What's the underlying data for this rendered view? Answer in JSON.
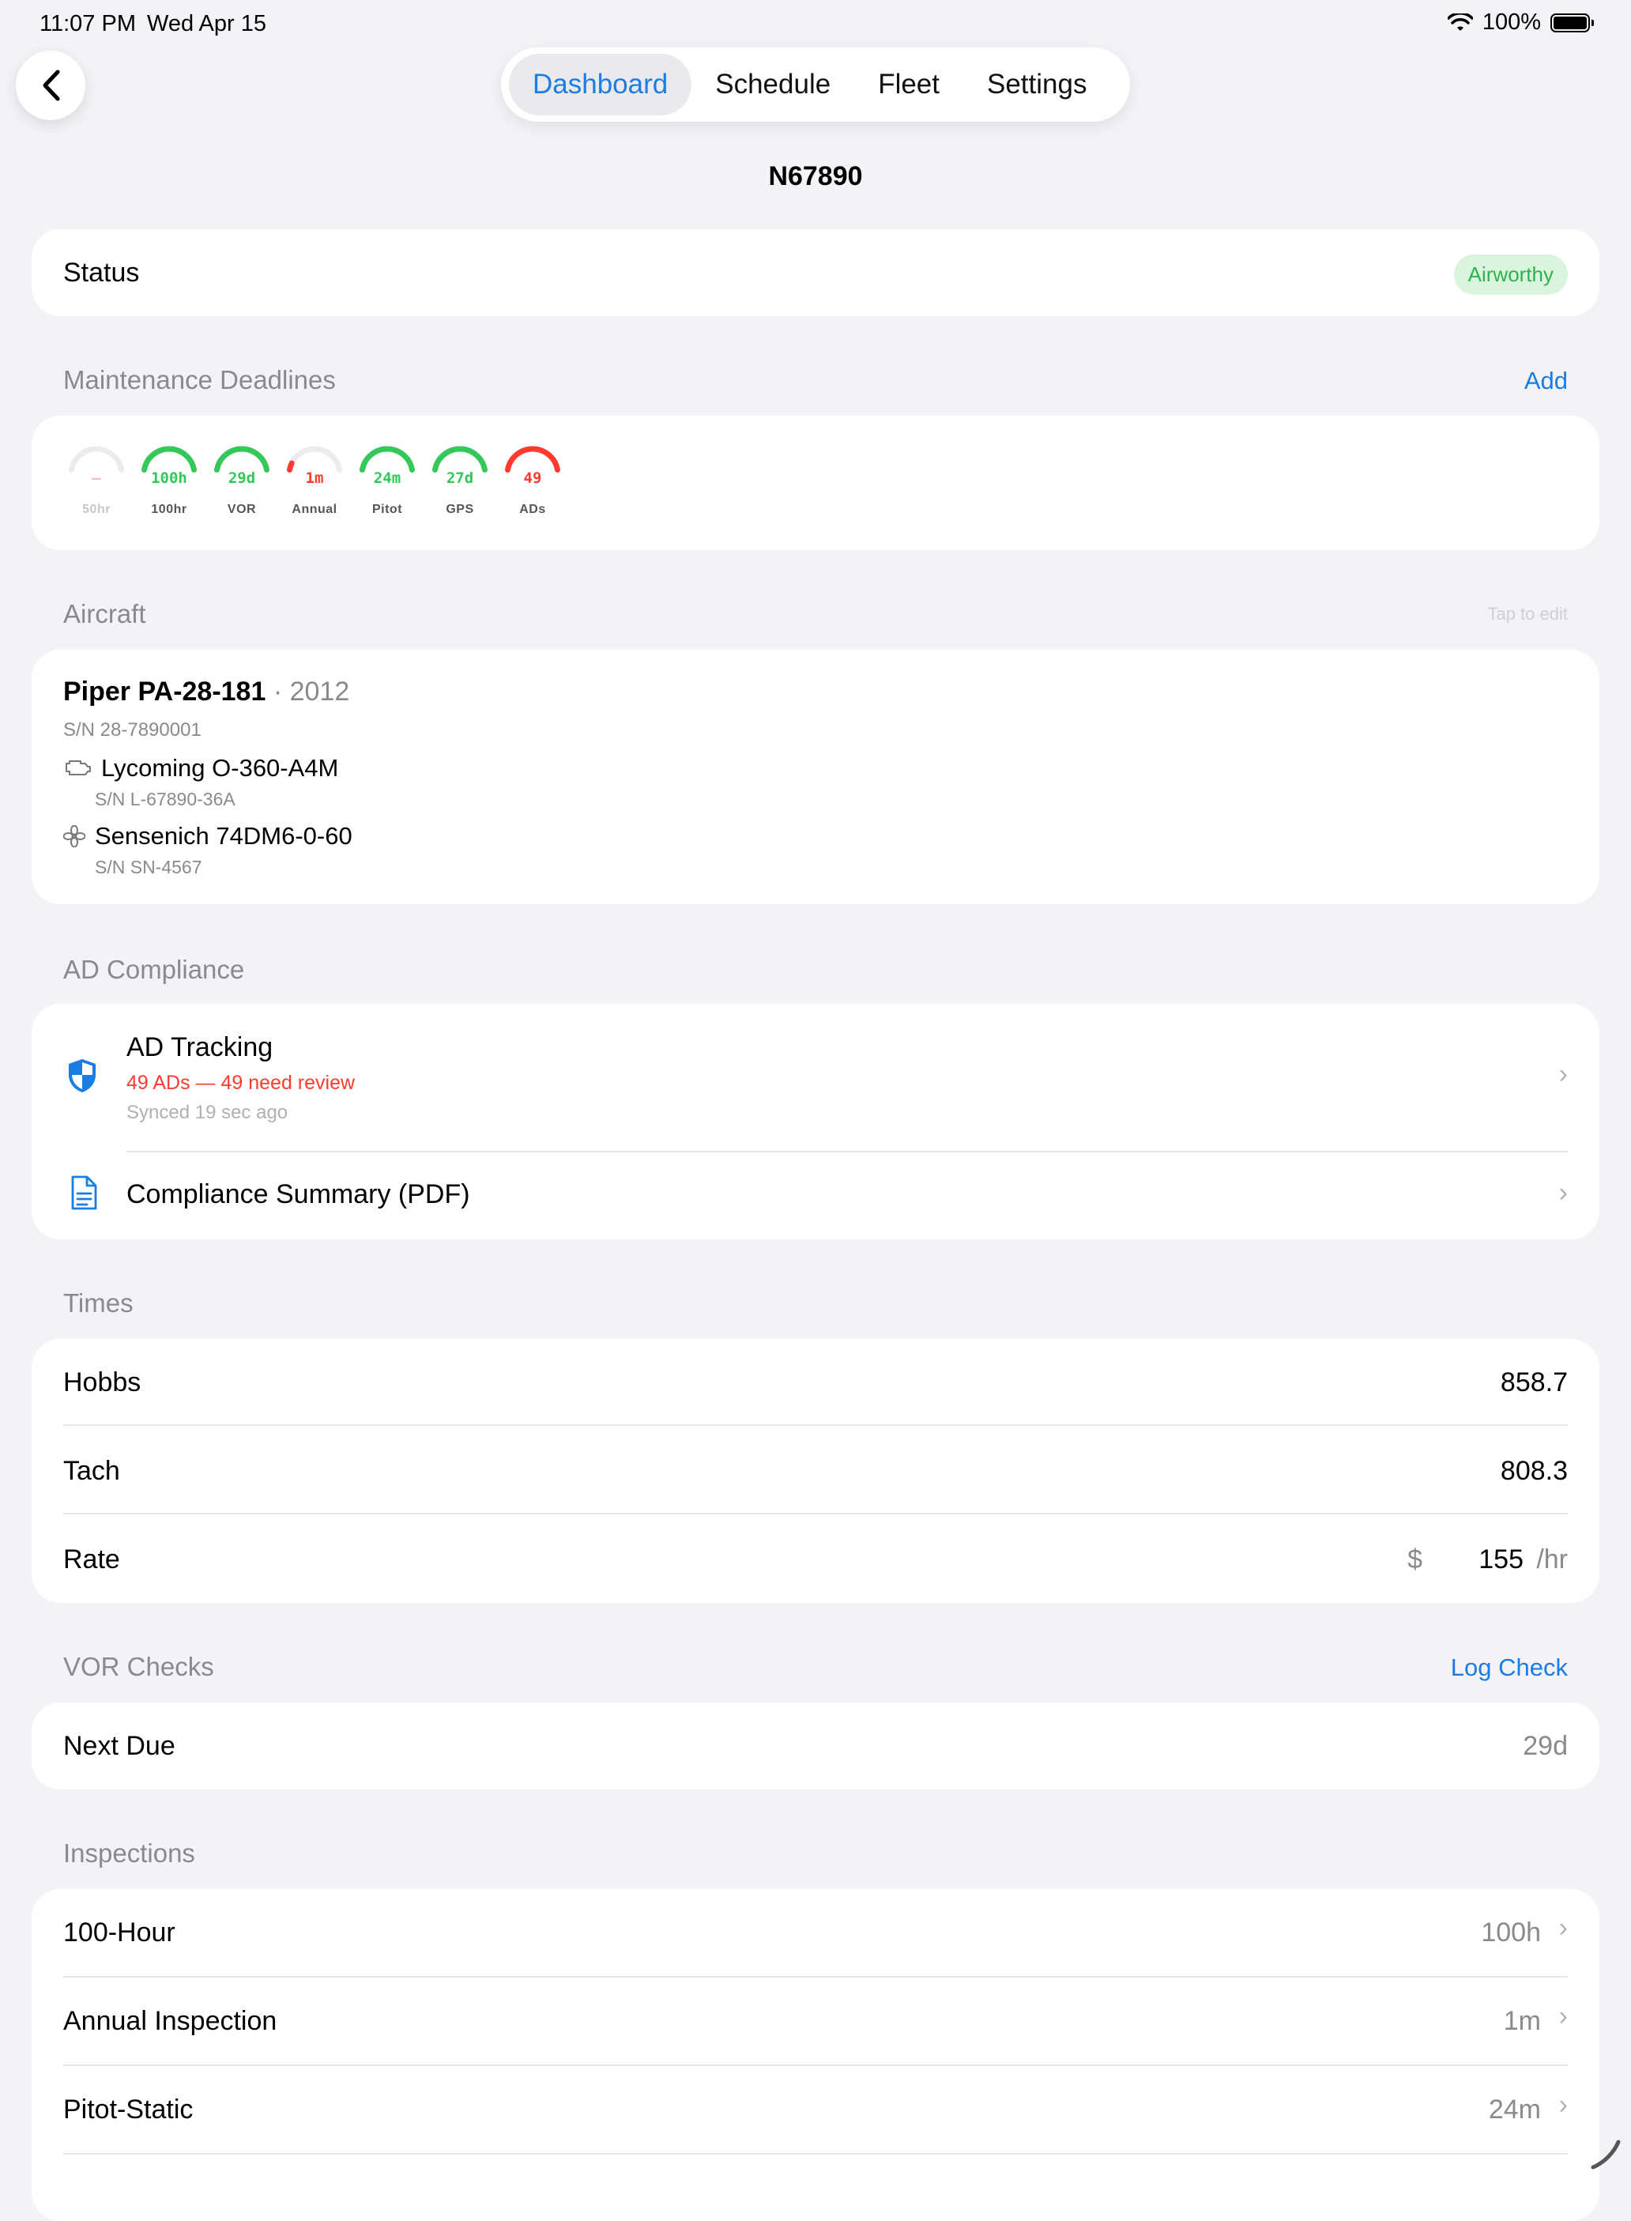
{
  "status_bar": {
    "time": "11:07 PM",
    "date": "Wed Apr 15",
    "battery": "100%"
  },
  "tabs": [
    {
      "label": "Dashboard",
      "active": true
    },
    {
      "label": "Schedule"
    },
    {
      "label": "Fleet"
    },
    {
      "label": "Settings"
    }
  ],
  "title": "N67890",
  "status": {
    "label": "Status",
    "badge": "Airworthy"
  },
  "maintenance": {
    "header": "Maintenance Deadlines",
    "action": "Add",
    "gauges": [
      {
        "value": "—",
        "label": "50hr",
        "color": "#f0a0a8",
        "level": 0.0,
        "faded": true
      },
      {
        "value": "100h",
        "label": "100hr",
        "color": "#34c759",
        "level": 1.0
      },
      {
        "value": "29d",
        "label": "VOR",
        "color": "#34c759",
        "level": 1.0
      },
      {
        "value": "1m",
        "label": "Annual",
        "color": "#ff3b30",
        "level": 0.1
      },
      {
        "value": "24m",
        "label": "Pitot",
        "color": "#34c759",
        "level": 1.0
      },
      {
        "value": "27d",
        "label": "GPS",
        "color": "#34c759",
        "level": 1.0
      },
      {
        "value": "49",
        "label": "ADs",
        "color": "#ff3b30",
        "level": 1.0
      }
    ]
  },
  "aircraft": {
    "header": "Aircraft",
    "hint": "Tap to edit",
    "model": "Piper PA-28-181",
    "year": "· 2012",
    "serial": "S/N 28-7890001",
    "engine": "Lycoming O-360-A4M",
    "engine_serial": "S/N L-67890-36A",
    "prop": "Sensenich 74DM6-0-60",
    "prop_serial": "S/N SN-4567"
  },
  "ad": {
    "header": "AD Compliance",
    "tracking_title": "AD Tracking",
    "tracking_status": "49 ADs — 49 need review",
    "tracking_sync": "Synced 19 sec ago",
    "summary": "Compliance Summary (PDF)"
  },
  "times": {
    "header": "Times",
    "hobbs_label": "Hobbs",
    "hobbs": "858.7",
    "tach_label": "Tach",
    "tach": "808.3",
    "rate_label": "Rate",
    "rate_currency": "$",
    "rate": "155",
    "rate_unit": "/hr"
  },
  "vor": {
    "header": "VOR Checks",
    "action": "Log Check",
    "next_label": "Next Due",
    "next_value": "29d"
  },
  "inspections": {
    "header": "Inspections",
    "items": [
      {
        "label": "100-Hour",
        "value": "100h"
      },
      {
        "label": "Annual Inspection",
        "value": "1m"
      },
      {
        "label": "Pitot-Static",
        "value": "24m"
      }
    ]
  }
}
